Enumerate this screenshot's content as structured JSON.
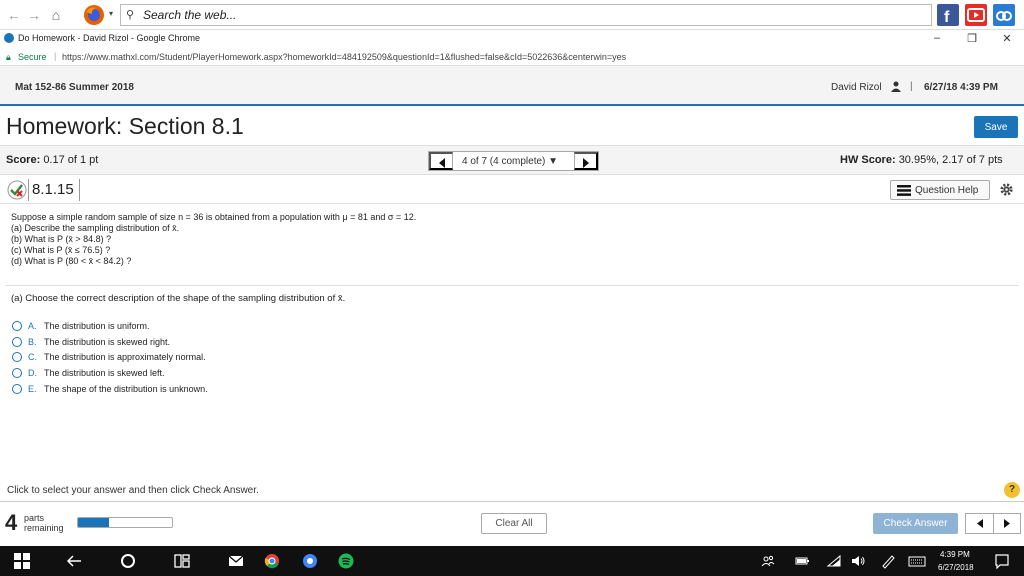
{
  "toolbar": {
    "search_placeholder": "Search the web..."
  },
  "chrome": {
    "tab_title": "Do Homework - David Rizol - Google Chrome",
    "secure_label": "Secure",
    "url": "https://www.mathxl.com/Student/PlayerHomework.aspx?homeworkId=484192509&questionId=1&flushed=false&cId=5022636&centerwin=yes"
  },
  "header": {
    "course": "Mat 152-86 Summer 2018",
    "user": "David Rizol",
    "separator": "|",
    "datetime": "6/27/18 4:39 PM"
  },
  "homework": {
    "title": "Homework: Section 8.1",
    "save_label": "Save",
    "score_label": "Score:",
    "score_value": "0.17 of 1 pt",
    "nav_status": "4 of 7 (4 complete) ▼",
    "hw_score_label": "HW Score:",
    "hw_score_value": "30.95%, 2.17 of 7 pts",
    "question_id": "8.1.15",
    "help_label": "Question Help"
  },
  "problem": {
    "lines": [
      "Suppose a simple random sample of size n = 36 is obtained from a population with μ = 81 and σ = 12.",
      "(a) Describe the sampling distribution of x̄.",
      "(b) What is P (x̄ > 84.8) ?",
      "(c) What is P (x̄ ≤ 76.5) ?",
      "(d) What is P (80 < x̄ < 84.2) ?"
    ],
    "prompt": "(a) Choose the correct description of the shape of the sampling distribution of x̄."
  },
  "options": [
    {
      "letter": "A.",
      "text": "The distribution is uniform."
    },
    {
      "letter": "B.",
      "text": "The distribution is skewed right."
    },
    {
      "letter": "C.",
      "text": "The distribution is approximately normal."
    },
    {
      "letter": "D.",
      "text": "The distribution is skewed left."
    },
    {
      "letter": "E.",
      "text": "The shape of the distribution is unknown."
    }
  ],
  "footer": {
    "instruction": "Click to select your answer and then click Check Answer.",
    "help_mark": "?",
    "parts_count": "4",
    "parts_label_1": "parts",
    "parts_label_2": "remaining",
    "progress_fraction": 0.33,
    "clear_label": "Clear All",
    "check_label": "Check Answer"
  },
  "taskbar": {
    "time": "4:39 PM",
    "date": "6/27/2018"
  },
  "colors": {
    "accent": "#1c74b8",
    "check_disabled": "#8fb3d4",
    "help_yellow": "#f2c12e"
  }
}
